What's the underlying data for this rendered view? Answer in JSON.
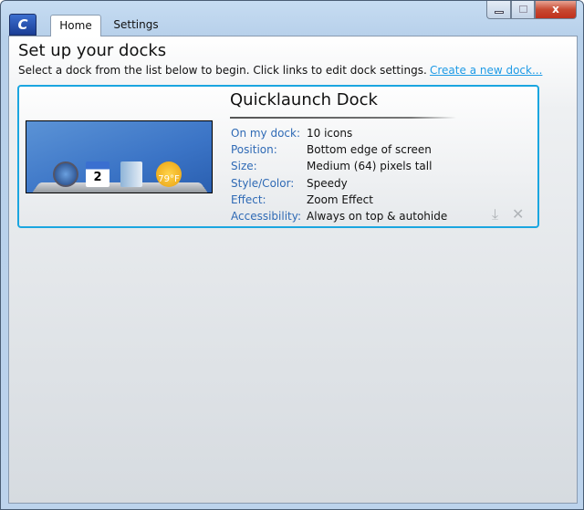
{
  "window": {
    "close_glyph": "x"
  },
  "tabs": [
    {
      "label": "Home"
    },
    {
      "label": "Settings"
    }
  ],
  "header": {
    "title": "Set up your docks",
    "subtitle": "Select a dock from the list below to begin. Click links to edit dock settings.",
    "create_link": "Create a new dock..."
  },
  "dock": {
    "name": "Quicklaunch Dock",
    "preview": {
      "calendar_day": "2",
      "weather_temp": "79°F"
    },
    "details": [
      {
        "label": "On my dock:",
        "value": "10 icons"
      },
      {
        "label": "Position:",
        "value": "Bottom edge of screen"
      },
      {
        "label": "Size:",
        "value": "Medium (64) pixels tall"
      },
      {
        "label": "Style/Color:",
        "value": "Speedy"
      },
      {
        "label": "Effect:",
        "value": "Zoom Effect"
      },
      {
        "label": "Accessibility:",
        "value": "Always on top & autohide"
      }
    ]
  },
  "colors": {
    "accent": "#1aa6e0",
    "label": "#2f6ab5"
  }
}
